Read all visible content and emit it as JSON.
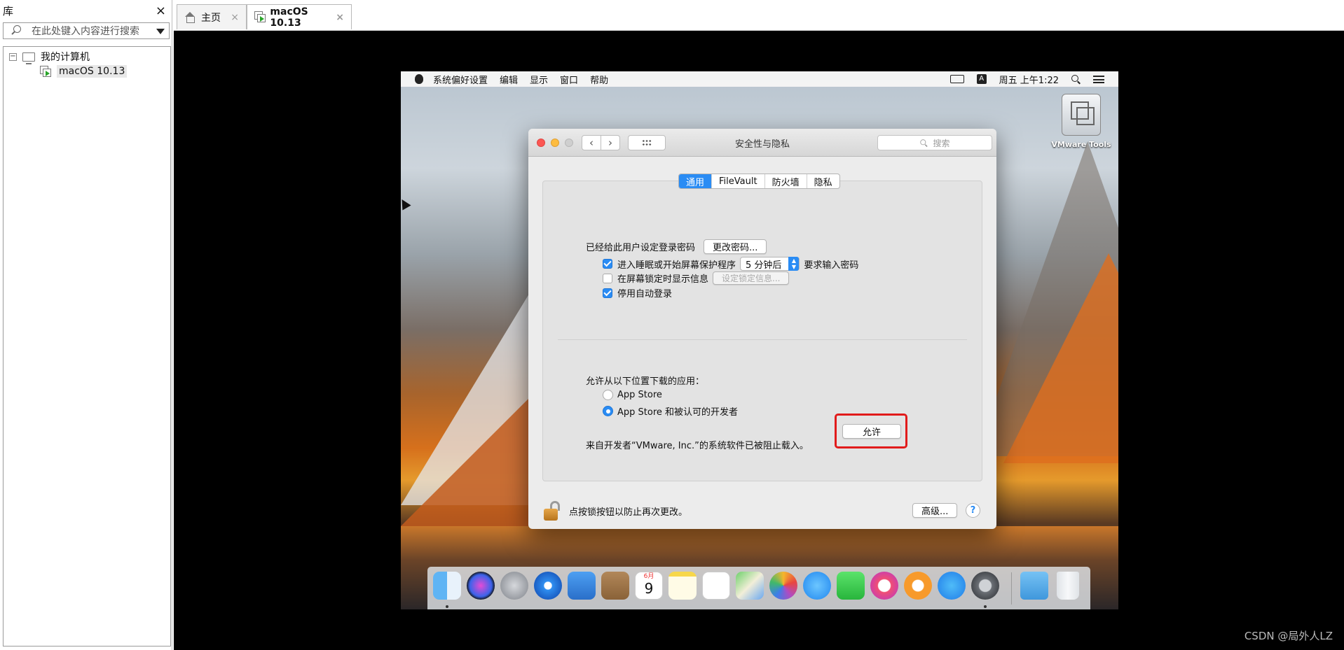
{
  "library": {
    "title": "库",
    "close": "×",
    "search_placeholder": "在此处键入内容进行搜索",
    "tree_root": "我的计算机",
    "tree_child": "macOS 10.13"
  },
  "tabs": [
    {
      "label": "主页"
    },
    {
      "label": "macOS 10.13"
    }
  ],
  "tab_close": "×",
  "mac": {
    "menu": [
      "系统偏好设置",
      "编辑",
      "显示",
      "窗口",
      "帮助"
    ],
    "status_a": "A",
    "clock": "周五 上午1:22",
    "desktop_icon": "VMware Tools"
  },
  "prefs": {
    "title": "安全性与隐私",
    "search_placeholder": "搜索",
    "tabs": [
      "通用",
      "FileVault",
      "防火墙",
      "隐私"
    ],
    "password_label": "已经给此用户设定登录密码",
    "change_password": "更改密码...",
    "require_pre": "进入睡眠或开始屏幕保护程序",
    "require_value": "5 分钟后",
    "require_post": "要求输入密码",
    "show_message": "在屏幕锁定时显示信息",
    "set_message": "设定锁定信息...",
    "disable_autologin": "停用自动登录",
    "allow_apps_label": "允许从以下位置下载的应用：",
    "radio_appstore": "App Store",
    "radio_identified": "App Store 和被认可的开发者",
    "blocked_text": "来自开发者“VMware, Inc.”的系统软件已被阻止载入。",
    "allow_button": "允许",
    "lock_text": "点按锁按钮以防止再次更改。",
    "advanced_button": "高级...",
    "help_button": "?"
  },
  "dock": {
    "calendar_month": "6月",
    "calendar_day": "9",
    "icons": [
      "finder-icon",
      "siri-icon",
      "launchpad-icon",
      "safari-icon",
      "mail-icon",
      "contacts-icon",
      "calendar-icon",
      "notes-icon",
      "reminders-icon",
      "maps-icon",
      "photos-icon",
      "messages-icon",
      "facetime-icon",
      "itunes-icon",
      "ibooks-icon",
      "app-store-icon",
      "system-preferences-icon",
      "downloads-icon",
      "trash-icon"
    ]
  },
  "watermark": "CSDN @局外人LZ"
}
